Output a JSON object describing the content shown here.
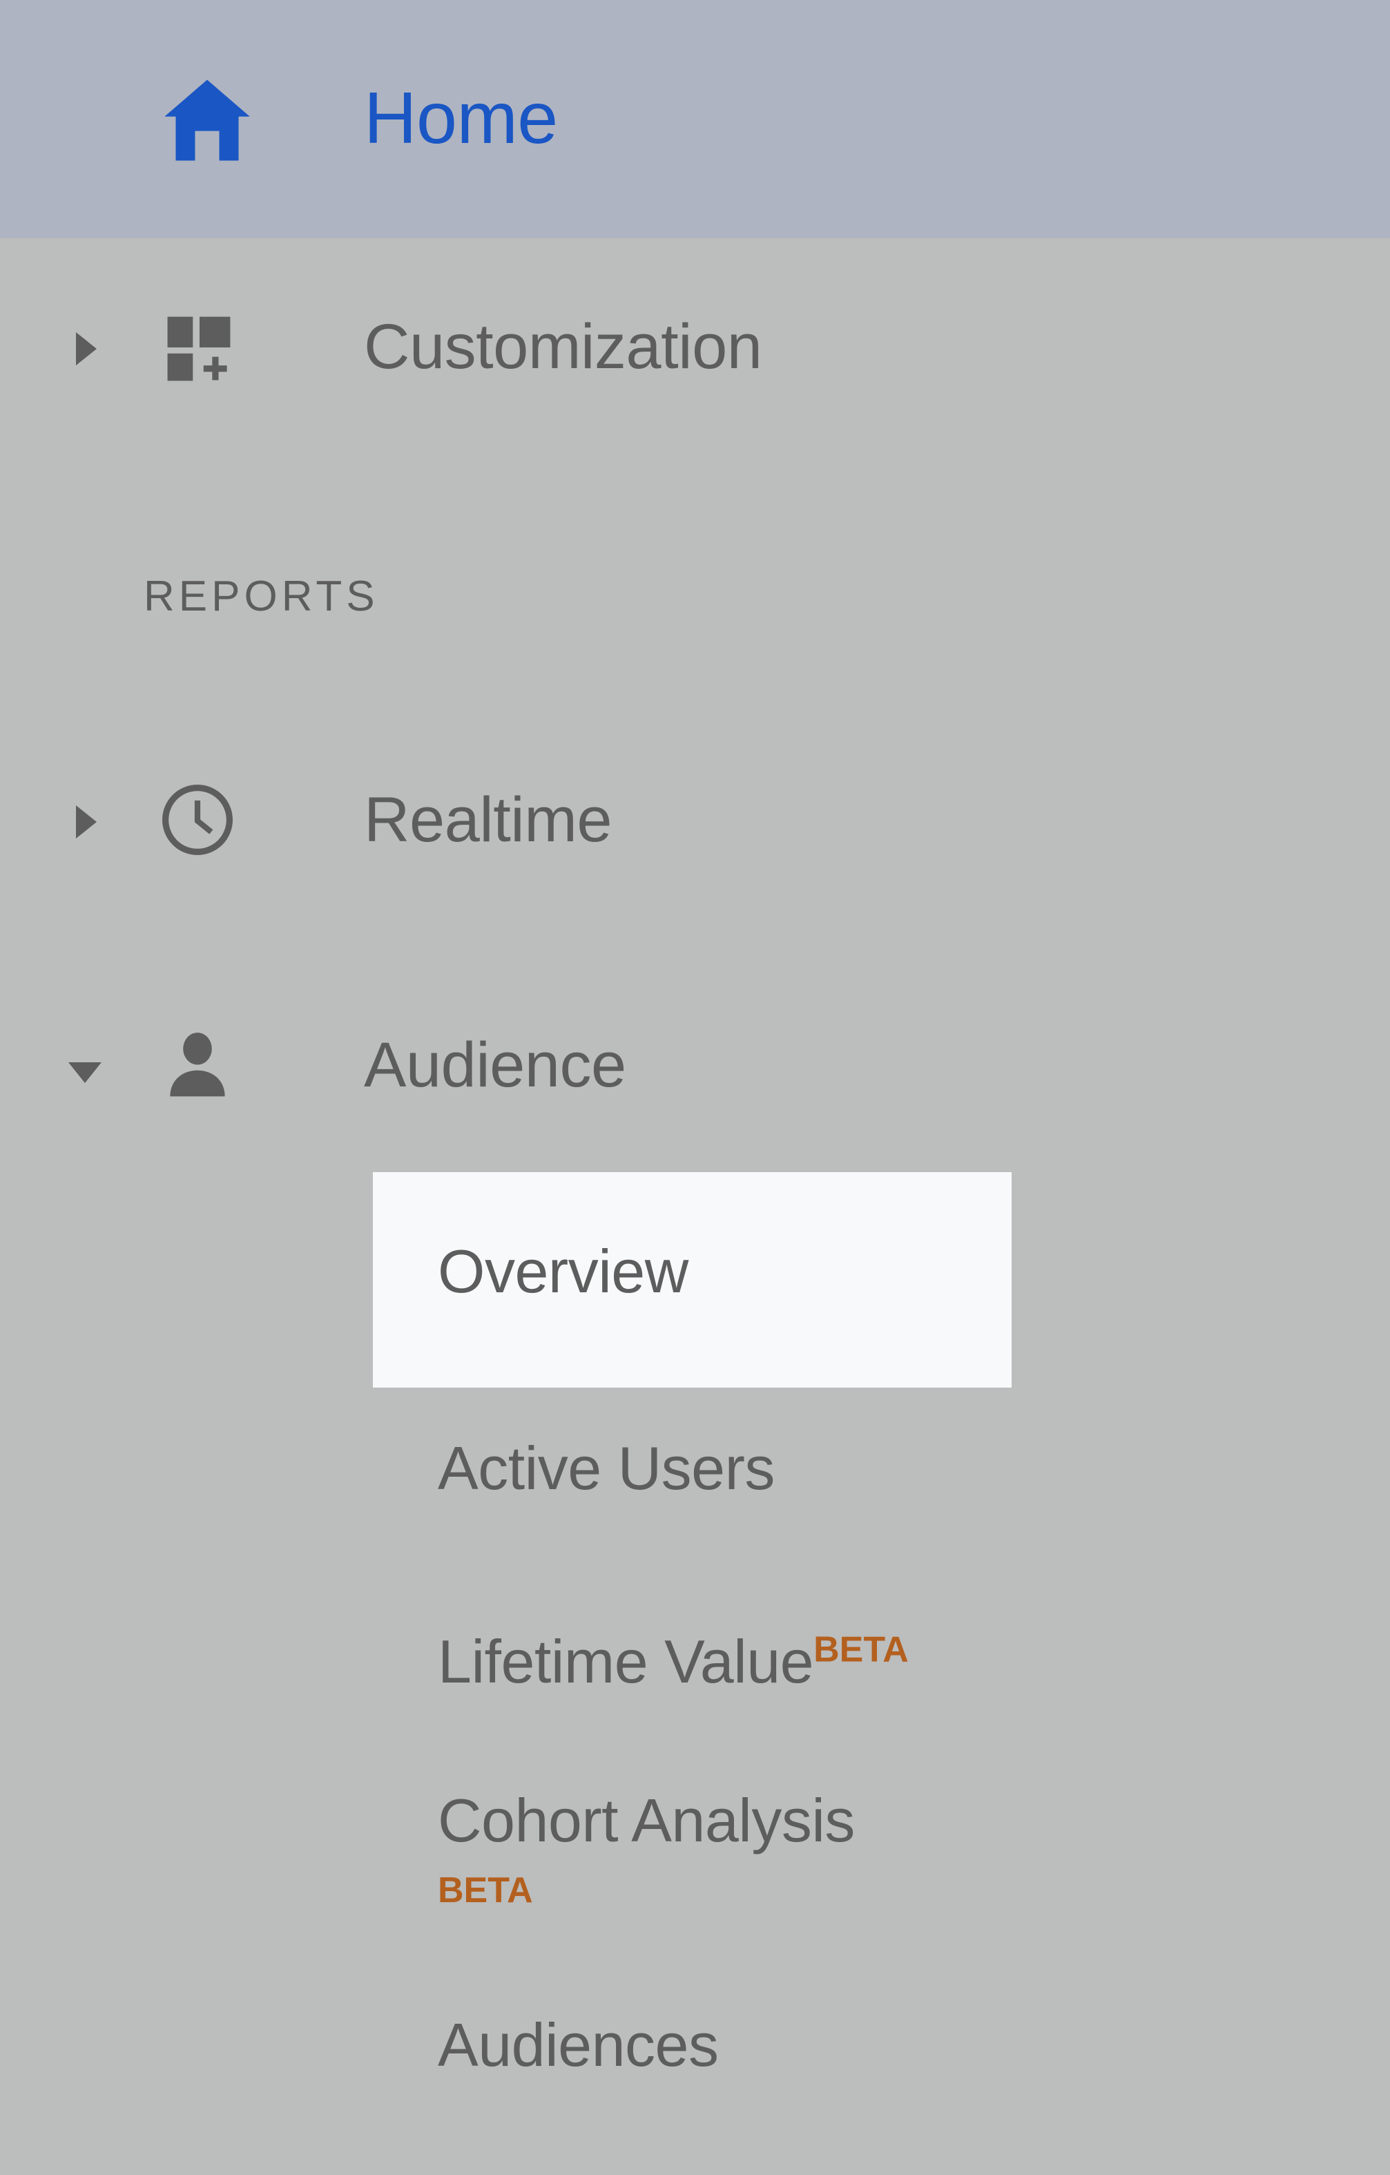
{
  "colors": {
    "sidebar_bg": "#bcbdbd",
    "home_row_bg": "#aeb4c2",
    "home_accent": "#1a56c4",
    "text": "#5d5d5d",
    "highlight_bg": "#f7f9fa",
    "beta_badge": "#b3601f"
  },
  "home": {
    "label": "Home",
    "icon": "home-icon"
  },
  "top_nav": [
    {
      "label": "Customization",
      "icon": "dashboard-plus-icon",
      "expander": "chevron-right",
      "expanded": false
    }
  ],
  "sections": [
    {
      "title": "REPORTS",
      "items": [
        {
          "label": "Realtime",
          "icon": "clock-icon",
          "expander": "chevron-right",
          "expanded": false
        },
        {
          "label": "Audience",
          "icon": "person-icon",
          "expander": "chevron-down",
          "expanded": true,
          "children": [
            {
              "label": "Overview",
              "selected": true,
              "badge": null
            },
            {
              "label": "Active Users",
              "selected": false,
              "badge": null
            },
            {
              "label": "Lifetime Value",
              "selected": false,
              "badge": "BETA",
              "badge_style": "superscript"
            },
            {
              "label": "Cohort Analysis",
              "selected": false,
              "badge": "BETA",
              "badge_style": "wrapped"
            },
            {
              "label": "Audiences",
              "selected": false,
              "badge": null
            }
          ]
        }
      ]
    }
  ]
}
